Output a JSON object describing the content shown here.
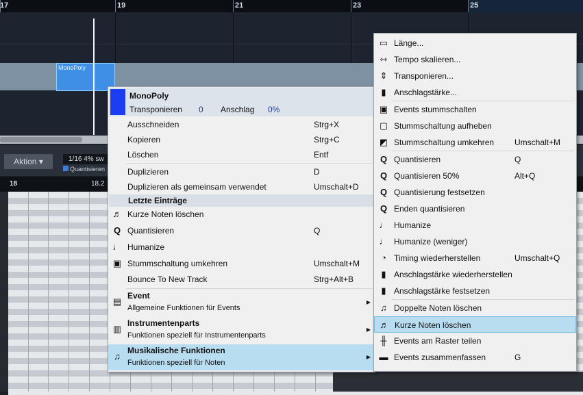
{
  "ruler": {
    "bars": [
      "17",
      "19",
      "21",
      "23",
      "25"
    ]
  },
  "arrangement": {
    "part_label": "MonoPoly"
  },
  "toolbar": {
    "aktion_label": "Aktion",
    "quantize_value": "1/16 4% sw",
    "quantize_sub": "Quantisieren"
  },
  "editor_ruler": {
    "labels": [
      "18",
      "18.2"
    ]
  },
  "context_menu": {
    "header": {
      "title": "MonoPoly",
      "transpose_label": "Transponieren",
      "transpose_value": "0",
      "velocity_label": "Anschlag",
      "velocity_value": "0%",
      "swatch_color": "#1b3ef2"
    },
    "items": [
      {
        "label": "Ausschneiden",
        "shortcut": "Strg+X",
        "icon": ""
      },
      {
        "label": "Kopieren",
        "shortcut": "Strg+C",
        "icon": ""
      },
      {
        "label": "Löschen",
        "shortcut": "Entf",
        "icon": ""
      },
      {
        "label": "Duplizieren",
        "shortcut": "D",
        "icon": ""
      },
      {
        "label": "Duplizieren als gemeinsam verwendet",
        "shortcut": "Umschalt+D",
        "icon": ""
      }
    ],
    "recent_header": "Letzte Einträge",
    "recent": [
      {
        "label": "Kurze Noten löschen",
        "shortcut": "",
        "icon": "short-notes-icon"
      },
      {
        "label": "Quantisieren",
        "shortcut": "Q",
        "icon": "quantize-icon"
      },
      {
        "label": "Humanize",
        "shortcut": "",
        "icon": "humanize-icon"
      },
      {
        "label": "Stummschaltung umkehren",
        "shortcut": "Umschalt+M",
        "icon": "mute-invert-icon"
      },
      {
        "label": "Bounce To New Track",
        "shortcut": "Strg+Alt+B",
        "icon": ""
      }
    ],
    "groups": [
      {
        "title": "Event",
        "subtitle": "Allgemeine Funktionen für Events",
        "icon": "event-icon"
      },
      {
        "title": "Instrumentenparts",
        "subtitle": "Funktionen speziell für Instrumentenparts",
        "icon": "instrument-part-icon"
      },
      {
        "title": "Musikalische Funktionen",
        "subtitle": "Funktionen speziell für Noten",
        "icon": "music-note-icon"
      }
    ]
  },
  "submenu": {
    "items": [
      {
        "label": "Länge...",
        "shortcut": "",
        "icon": "length-icon"
      },
      {
        "label": "Tempo skalieren...",
        "shortcut": "",
        "icon": "tempo-scale-icon"
      },
      {
        "label": "Transponieren...",
        "shortcut": "",
        "icon": "transpose-icon"
      },
      {
        "label": "Anschlagstärke...",
        "shortcut": "",
        "icon": "velocity-icon"
      },
      {
        "label": "Events stummschalten",
        "shortcut": "",
        "icon": "mute-icon"
      },
      {
        "label": "Stummschaltung aufheben",
        "shortcut": "",
        "icon": "unmute-icon"
      },
      {
        "label": "Stummschaltung umkehren",
        "shortcut": "Umschalt+M",
        "icon": "mute-invert-icon"
      },
      {
        "label": "Quantisieren",
        "shortcut": "Q",
        "icon": "quantize-icon"
      },
      {
        "label": "Quantisieren 50%",
        "shortcut": "Alt+Q",
        "icon": "quantize-50-icon"
      },
      {
        "label": "Quantisierung festsetzen",
        "shortcut": "",
        "icon": "quantize-freeze-icon"
      },
      {
        "label": "Enden quantisieren",
        "shortcut": "",
        "icon": "quantize-ends-icon"
      },
      {
        "label": "Humanize",
        "shortcut": "",
        "icon": "humanize-icon"
      },
      {
        "label": "Humanize (weniger)",
        "shortcut": "",
        "icon": "humanize-less-icon"
      },
      {
        "label": "Timing wiederherstellen",
        "shortcut": "Umschalt+Q",
        "icon": "timing-restore-icon"
      },
      {
        "label": "Anschlagstärke wiederherstellen",
        "shortcut": "",
        "icon": "velocity-restore-icon"
      },
      {
        "label": "Anschlagstärke festsetzen",
        "shortcut": "",
        "icon": "velocity-freeze-icon"
      },
      {
        "label": "Doppelte Noten löschen",
        "shortcut": "",
        "icon": "duplicate-notes-icon"
      },
      {
        "label": "Kurze Noten löschen",
        "shortcut": "",
        "icon": "short-notes-icon"
      },
      {
        "label": "Events am Raster teilen",
        "shortcut": "",
        "icon": "split-grid-icon"
      },
      {
        "label": "Events zusammenfassen",
        "shortcut": "G",
        "icon": "merge-icon"
      }
    ]
  }
}
